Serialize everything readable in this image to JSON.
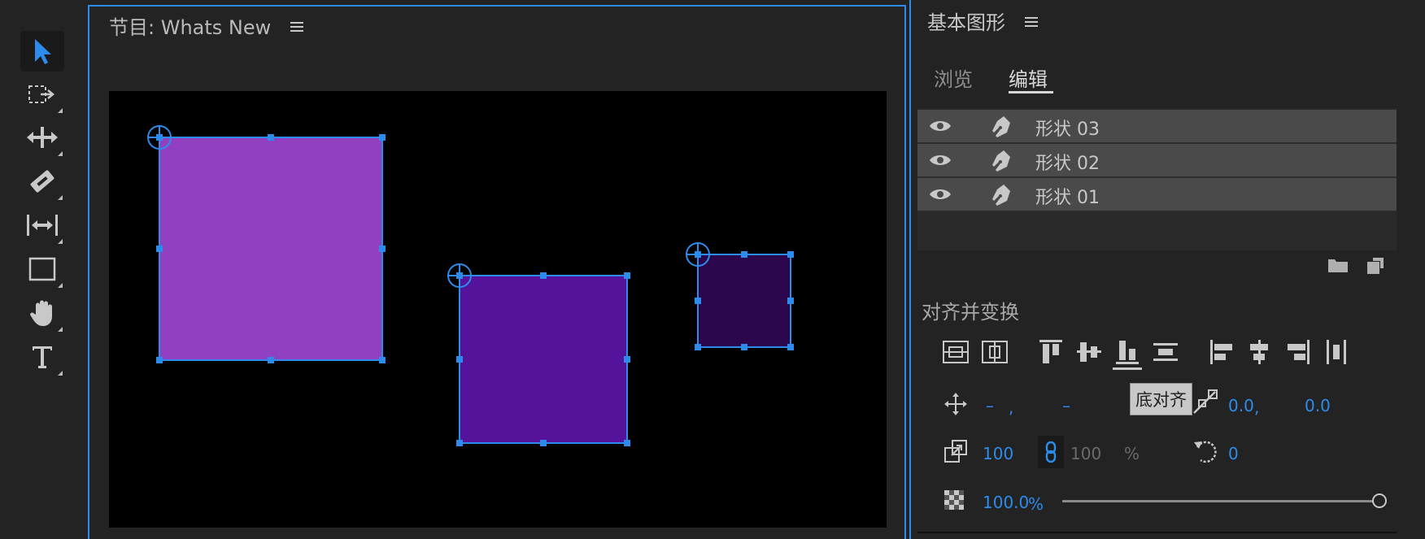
{
  "program": {
    "title": "节目: Whats New"
  },
  "panel": {
    "title": "基本图形",
    "tabs": [
      {
        "label": "浏览",
        "active": false
      },
      {
        "label": "编辑",
        "active": true
      }
    ],
    "layers": [
      {
        "name": "形状 03"
      },
      {
        "name": "形状 02"
      },
      {
        "name": "形状 01"
      }
    ],
    "section_title": "对齐并变换",
    "tooltip": "底对齐",
    "position": {
      "x": "–",
      "sep": ",",
      "y": "–"
    },
    "anchor": {
      "x": "0.0",
      "sep": ",",
      "y": "0.0"
    },
    "scale": {
      "value": "100",
      "linked_value": "100",
      "unit": "%"
    },
    "rotation": "0",
    "opacity": {
      "value": "100.0",
      "unit": "%",
      "level": 1.0
    }
  },
  "colors": {
    "accent": "#2d8ceb",
    "shape_large": "#9040c0",
    "shape_medium": "#55129b",
    "shape_small": "#2c064c"
  }
}
